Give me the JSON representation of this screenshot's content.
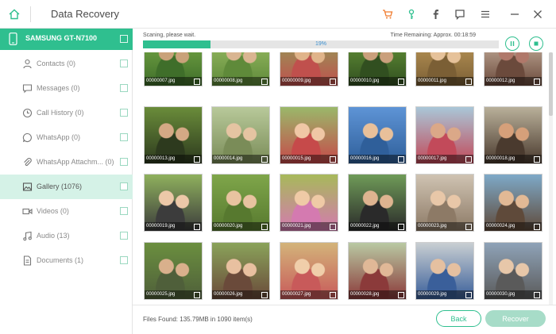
{
  "title_bar": {
    "title": "Data Recovery",
    "icons": [
      "home-icon",
      "cart-icon",
      "key-icon",
      "facebook-icon",
      "feedback-icon",
      "menu-icon",
      "minimize-icon",
      "close-icon"
    ]
  },
  "colors": {
    "accent": "#2fbf8f",
    "active_row": "#d5f2e7",
    "recover_disabled": "#a7dcc8",
    "progress_text": "#3a8fd0"
  },
  "sidebar": {
    "device": {
      "name": "SAMSUNG GT-N7100",
      "icon": "phone-icon"
    },
    "items": [
      {
        "label": "Contacts (0)",
        "icon": "contacts-icon"
      },
      {
        "label": "Messages (0)",
        "icon": "message-icon"
      },
      {
        "label": "Call History (0)",
        "icon": "clock-icon"
      },
      {
        "label": "WhatsApp (0)",
        "icon": "whatsapp-icon"
      },
      {
        "label": "WhatsApp Attachm... (0)",
        "icon": "paperclip-icon"
      },
      {
        "label": "Gallery (1076)",
        "icon": "image-icon",
        "active": true
      },
      {
        "label": "Videos (0)",
        "icon": "video-icon"
      },
      {
        "label": "Audio (13)",
        "icon": "music-icon"
      },
      {
        "label": "Documents (1)",
        "icon": "document-icon"
      }
    ]
  },
  "scan": {
    "status": "Scaning, please wait.",
    "time_remaining": "Time Remaining: Approx. 00:18:59",
    "progress_label": "19%",
    "progress_fraction": 0.19
  },
  "gallery": {
    "files": [
      "00000007.jpg",
      "00000008.jpg",
      "00000009.jpg",
      "00000010.jpg",
      "00000011.jpg",
      "00000012.jpg",
      "00000013.jpg",
      "00000014.jpg",
      "00000015.jpg",
      "00000016.jpg",
      "00000017.jpg",
      "00000018.jpg",
      "00000019.jpg",
      "00000020.jpg",
      "00000021.jpg",
      "00000022.jpg",
      "00000023.jpg",
      "00000024.jpg",
      "00000025.jpg",
      "00000026.jpg",
      "00000027.jpg",
      "00000028.jpg",
      "00000029.jpg",
      "00000030.jpg"
    ]
  },
  "footer": {
    "files_found": "Files Found: 135.79MB in 1090 item(s)",
    "back_label": "Back",
    "recover_label": "Recover"
  }
}
